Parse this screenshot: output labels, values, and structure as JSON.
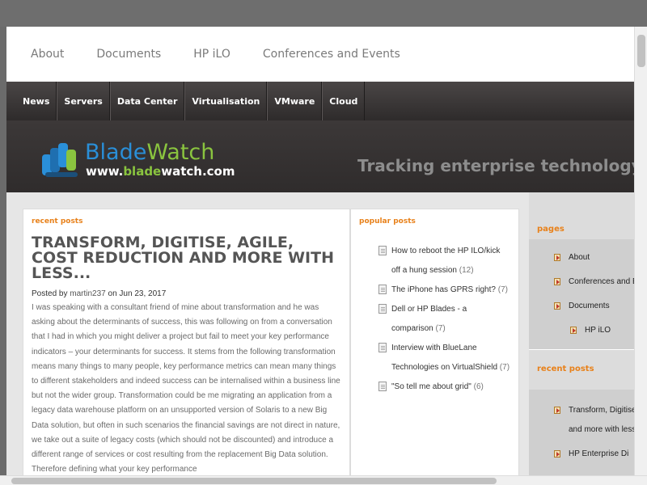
{
  "top_links": [
    "About",
    "Documents",
    "HP iLO",
    "Conferences and Events"
  ],
  "category_nav": [
    "News",
    "Servers",
    "Data Center",
    "Virtualisation",
    "VMware",
    "Cloud"
  ],
  "logo": {
    "name_part1": "Blade",
    "name_part2": "Watch",
    "url_part1": "www.",
    "url_part2": "blade",
    "url_part3": "watch.com"
  },
  "tagline": "Tracking enterprise technology tr",
  "main": {
    "section_title": "recent posts",
    "post_title": "TRANSFORM, DIGITISE, AGILE, COST REDUCTION AND MORE WITH LESS...",
    "posted_by_label": "Posted by",
    "author": "martin237",
    "on_label": "on",
    "date": "Jun 23, 2017",
    "body": "I was speaking with a consultant friend of mine about transformation and he was asking about the determinants of success, this was following on from a conversation that I had in which you might deliver a project but fail to meet your key performance indicators – your determinants for success. It stems from the following transformation means many things to many people, key performance metrics can mean many things to different stakeholders and indeed success can be internalised within a business line but not the wider group. Transformation could be me migrating an application from a legacy data warehouse platform on an unsupported version of Solaris to a new Big Data solution, but often in such scenarios the financial savings are not direct in nature, we take out a suite of legacy costs (which should not be discounted) and introduce a different range of services or cost resulting from the replacement Big Data solution. Therefore defining what your key performance"
  },
  "popular": {
    "section_title": "popular posts",
    "items": [
      {
        "title": "How to reboot the HP ILO/kick off a hung session",
        "count": "(12)"
      },
      {
        "title": "The iPhone has GPRS right?",
        "count": "(7)"
      },
      {
        "title": "Dell or HP Blades - a comparison",
        "count": "(7)"
      },
      {
        "title": "Interview with BlueLane Technologies on VirtualShield",
        "count": "(7)"
      },
      {
        "title": "\"So tell me about grid\"",
        "count": "(6)"
      }
    ]
  },
  "sidebar": {
    "pages_title": "pages",
    "pages": [
      "About",
      "Conferences and Events",
      "Documents",
      "HP iLO"
    ],
    "recent_title": "recent posts",
    "recent": [
      "Transform, Digitise, Agile, Cost Reduction and more with less",
      "HP Enterprise Di"
    ]
  },
  "colors": {
    "accent": "#e8811a",
    "nav_bg": "#2e2b2b",
    "logo_blue": "#2a8fd8",
    "logo_green": "#8ac43f"
  }
}
